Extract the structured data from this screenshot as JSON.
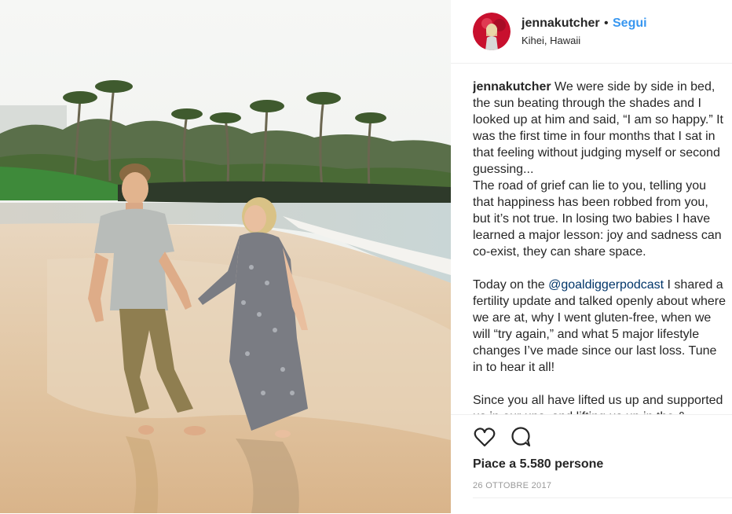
{
  "post": {
    "username": "jennakutcher",
    "separator": "•",
    "follow_label": "Segui",
    "location": "Kihei, Hawaii",
    "caption_user": "jennakutcher",
    "caption_part1": " We were side by side in bed, the sun beating through the shades and I looked up at him and said, “I am so happy.” It was the first time in four months that I sat in that feeling without judging myself or second guessing...\nThe road of grief can lie to you, telling you that happiness has been robbed from you, but it’s not true. In losing two babies I have learned a major lesson: joy and sadness can co-exist, they can share space.\n\nToday on the ",
    "caption_mention": "@goaldiggerpodcast",
    "caption_part2": " I shared a fertility update and talked openly about where we are at, why I went gluten-free, when we will “try again,” and what 5 major lifestyle changes I’ve made since our last loss. Tune in to hear it all!\n\nSince you all have lifted us up and supported us in our ups, and lifting us up in the & ...",
    "likes_text": "Piace a 5.580 persone",
    "date": "26 OTTOBRE 2017"
  },
  "icons": {
    "like": "heart-icon",
    "comment": "comment-bubble-icon"
  },
  "colors": {
    "link": "#3897f0",
    "mention": "#003569",
    "muted": "#999999"
  }
}
